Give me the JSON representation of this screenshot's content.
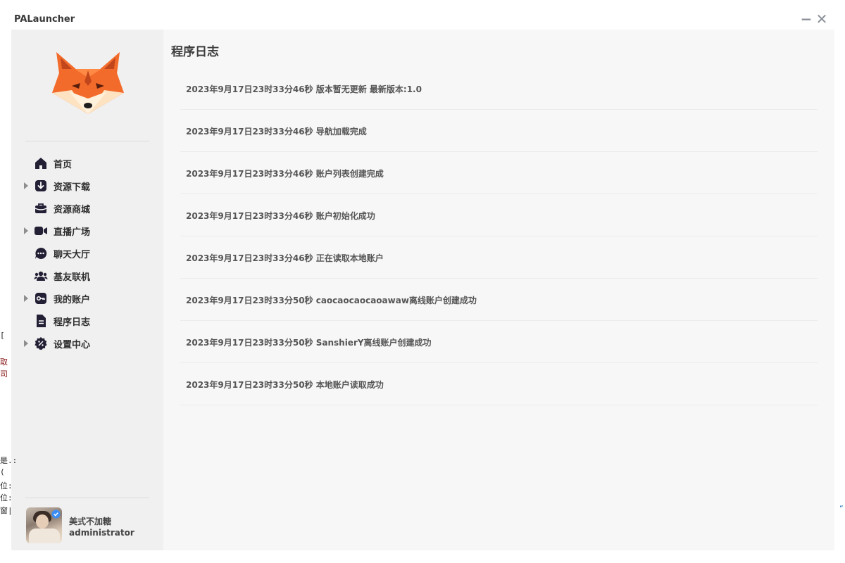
{
  "app": {
    "title": "PALauncher"
  },
  "window_controls": {
    "minimize": "−",
    "close": "✕"
  },
  "sidebar": {
    "items": [
      {
        "label": "首页",
        "icon": "home-icon",
        "expandable": false
      },
      {
        "label": "资源下载",
        "icon": "download-icon",
        "expandable": true
      },
      {
        "label": "资源商城",
        "icon": "shop-icon",
        "expandable": false
      },
      {
        "label": "直播广场",
        "icon": "video-camera-icon",
        "expandable": true
      },
      {
        "label": "聊天大厅",
        "icon": "chat-bubble-icon",
        "expandable": false
      },
      {
        "label": "基友联机",
        "icon": "users-icon",
        "expandable": false
      },
      {
        "label": "我的账户",
        "icon": "key-icon",
        "expandable": true
      },
      {
        "label": "程序日志",
        "icon": "file-text-icon",
        "expandable": false
      },
      {
        "label": "设置中心",
        "icon": "settings-badge-icon",
        "expandable": true
      }
    ]
  },
  "user": {
    "name": "美式不加糖",
    "role": "administrator"
  },
  "main": {
    "title": "程序日志",
    "logs": [
      "2023年9月17日23时33分46秒 版本暂无更新 最新版本:1.0",
      "2023年9月17日23时33分46秒 导航加载完成",
      "2023年9月17日23时33分46秒 账户列表创建完成",
      "2023年9月17日23时33分46秒 账户初始化成功",
      "2023年9月17日23时33分46秒 正在读取本地账户",
      "2023年9月17日23时33分50秒 caocaocaocaoawaw离线账户创建成功",
      "2023年9月17日23时33分50秒 SanshierY离线账户创建成功",
      "2023年9月17日23时33分50秒 本地账户读取成功"
    ]
  },
  "edge_fragments": {
    "left": [
      "[",
      "取",
      "司",
      "是.:",
      "(",
      "位:",
      "位:",
      "窗|"
    ],
    "right": "“"
  },
  "colors": {
    "fox_orange": "#f26b2a",
    "fox_dark": "#c2461c",
    "fox_cream": "#fde3c2",
    "icon_dark": "#231f35",
    "sidebar_bg": "#f0f0f0",
    "main_bg": "#f7f7f7",
    "verify_blue": "#3b8ef5"
  }
}
